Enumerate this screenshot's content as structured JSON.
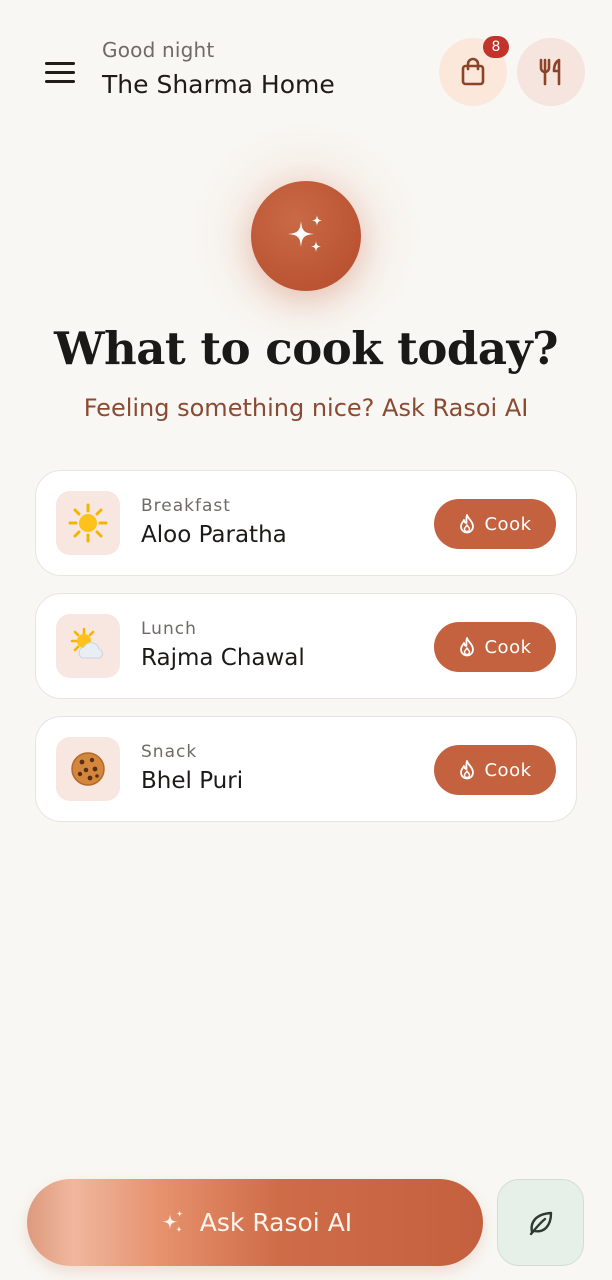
{
  "header": {
    "greeting": "Good night",
    "home_name": "The Sharma Home",
    "cart_badge": "8",
    "icons": {
      "menu": "menu-icon",
      "bag": "shopping-bag-icon",
      "utensils": "utensils-icon"
    }
  },
  "hero": {
    "icon": "sparkles-icon",
    "title": "What to cook today?",
    "subtitle": "Feeling something nice? Ask Rasoi AI"
  },
  "meals": [
    {
      "type": "Breakfast",
      "name": "Aloo Paratha",
      "icon": "sun-emoji",
      "emoji": "☀️",
      "cook_label": "Cook"
    },
    {
      "type": "Lunch",
      "name": "Rajma Chawal",
      "icon": "sun-behind-cloud-emoji",
      "emoji": "🌤️",
      "cook_label": "Cook"
    },
    {
      "type": "Snack",
      "name": "Bhel Puri",
      "icon": "cookie-emoji",
      "emoji": "🍪",
      "cook_label": "Cook"
    }
  ],
  "bottom_bar": {
    "ask_label": "Ask Rasoi AI",
    "ask_icon": "sparkles-icon",
    "secondary_icon": "leaf-icon"
  },
  "colors": {
    "background": "#f8f7f3",
    "accent": "#c4613f",
    "subtitle": "#8a4b33",
    "badge": "#c2332b"
  }
}
